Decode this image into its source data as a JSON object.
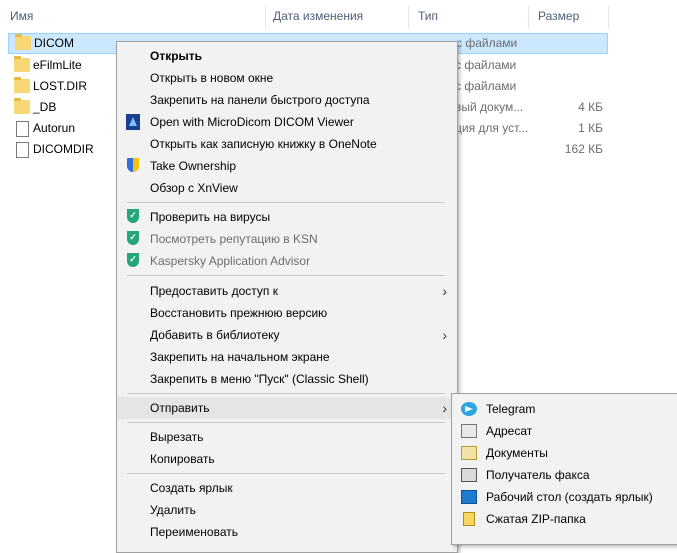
{
  "columns": {
    "name": "Имя",
    "date": "Дата изменения",
    "type": "Тип",
    "size": "Размер"
  },
  "files": [
    {
      "name": "DICOM",
      "type": "с файлами",
      "size": ""
    },
    {
      "name": "eFilmLite",
      "type": "с файлами",
      "size": ""
    },
    {
      "name": "LOST.DIR",
      "type": "с файлами",
      "size": ""
    },
    {
      "name": "_DB",
      "type": "вый докум...",
      "size": "4 КБ"
    },
    {
      "name": "Autorun",
      "type": "ция для уст...",
      "size": "1 КБ"
    },
    {
      "name": "DICOMDIR",
      "type": "",
      "size": "162 КБ"
    }
  ],
  "menu": {
    "items": [
      "Открыть",
      "Открыть в новом окне",
      "Закрепить на панели быстрого доступа",
      "Open with MicroDicom DICOM Viewer",
      "Открыть как записную книжку в OneNote",
      "Take Ownership",
      "Обзор с XnView",
      "Проверить на вирусы",
      "Посмотреть репутацию в KSN",
      "Kaspersky Application Advisor",
      "Предоставить доступ к",
      "Восстановить прежнюю версию",
      "Добавить в библиотеку",
      "Закрепить на начальном экране",
      "Закрепить в меню \"Пуск\" (Classic Shell)",
      "Отправить",
      "Вырезать",
      "Копировать",
      "Создать ярлык",
      "Удалить",
      "Переименовать"
    ]
  },
  "sendto": {
    "items": [
      "Telegram",
      "Адресат",
      "Документы",
      "Получатель факса",
      "Рабочий стол (создать ярлык)",
      "Сжатая ZIP-папка"
    ]
  },
  "colors": {
    "selection": "#cce8ff",
    "highlight_marker": "#ffff2e",
    "kaspersky": "#26a47a"
  }
}
